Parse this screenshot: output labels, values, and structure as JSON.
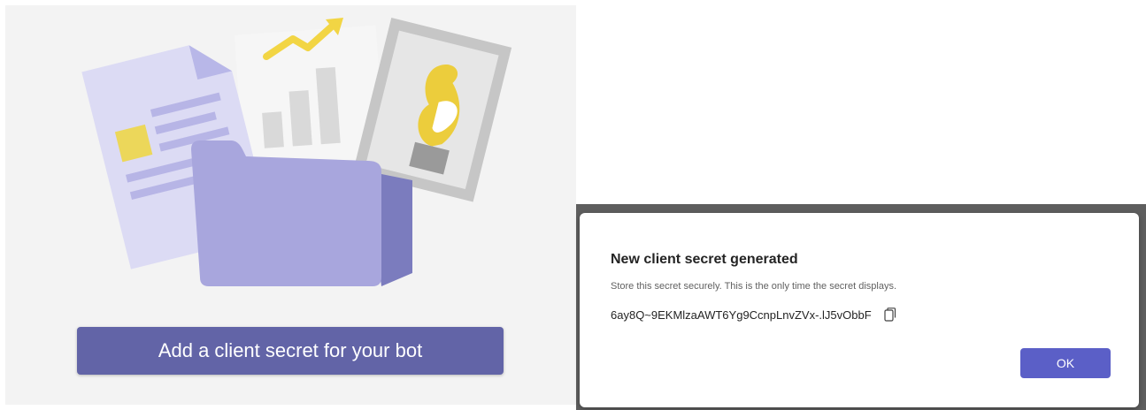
{
  "left_panel": {
    "add_button_label": "Add a client secret for your bot",
    "illustration_icon": "folder-documents-illustration"
  },
  "dialog": {
    "title": "New client secret generated",
    "description": "Store this secret securely. This is the only time the secret displays.",
    "secret_value": "6ay8Q~9EKMlzaAWT6Yg9CcnpLnvZVx-.lJ5vObbF",
    "copy_icon": "copy-icon",
    "ok_label": "OK"
  },
  "colors": {
    "brand_purple": "#6264a7",
    "ok_button": "#5b5fc7",
    "overlay": "#5e5e5e",
    "panel_bg": "#f3f3f3"
  }
}
